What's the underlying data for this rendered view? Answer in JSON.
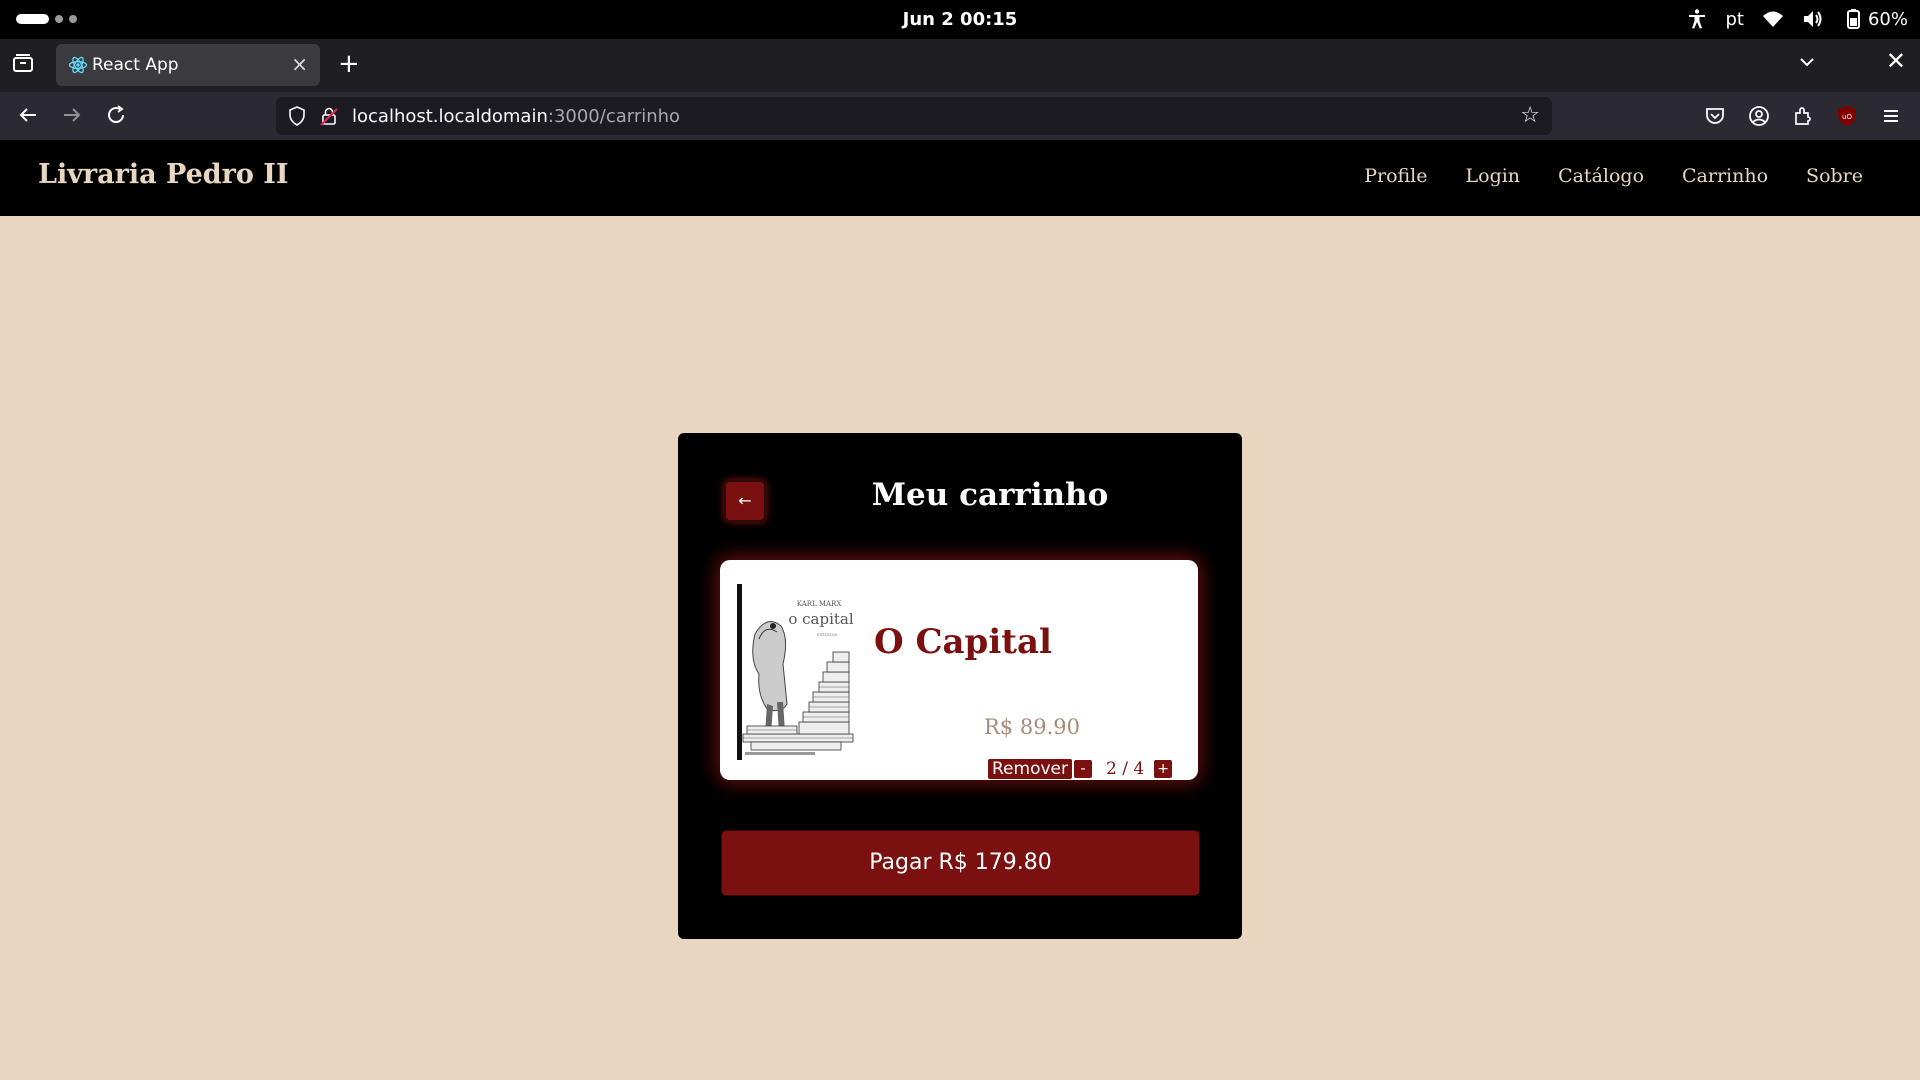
{
  "os": {
    "clock": "Jun 2  00:15",
    "language": "pt",
    "battery": "60%"
  },
  "browser": {
    "tab_title": "React App",
    "url_host": "localhost.localdomain",
    "url_path": ":3000/carrinho"
  },
  "site": {
    "brand": "Livraria Pedro II",
    "nav": [
      "Profile",
      "Login",
      "Catálogo",
      "Carrinho",
      "Sobre"
    ]
  },
  "cart": {
    "title": "Meu carrinho",
    "back_glyph": "←",
    "items": [
      {
        "name": "O Capital",
        "price": "R$ 89.90",
        "remove_label": "Remover",
        "decrement": "-",
        "increment": "+",
        "quantity": "2 / 4",
        "cover_text": {
          "author": "KARL MARX",
          "title": "o capital",
          "subtitle": "extratos"
        }
      }
    ],
    "pay_label": "Pagar R$ 179.80"
  },
  "colors": {
    "background": "#e8d6c1",
    "accent": "#7a1010",
    "header": "#000000"
  }
}
